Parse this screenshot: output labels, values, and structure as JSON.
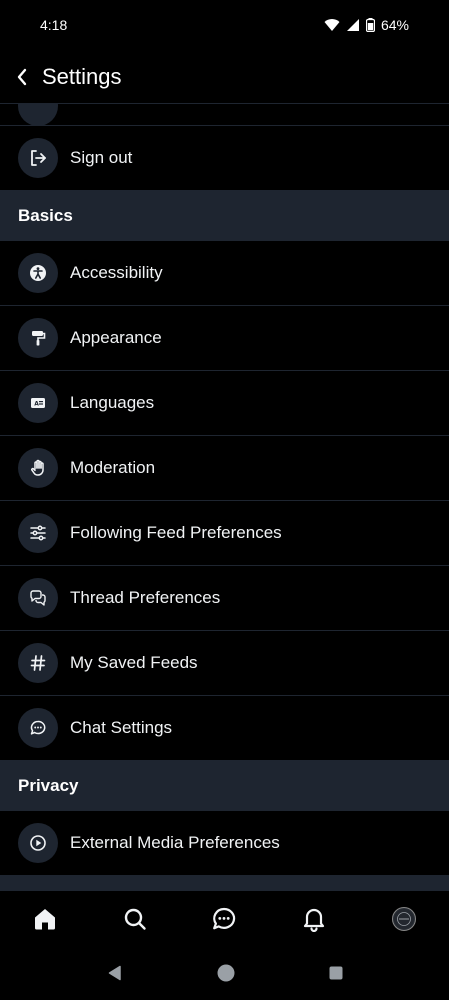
{
  "status_bar": {
    "time": "4:18",
    "battery": "64%"
  },
  "header": {
    "title": "Settings"
  },
  "rows_top": [
    {
      "label": "Sign out",
      "icon": "sign-out-icon"
    }
  ],
  "sections": [
    {
      "title": "Basics",
      "items": [
        {
          "label": "Accessibility",
          "icon": "accessibility-icon"
        },
        {
          "label": "Appearance",
          "icon": "paint-roller-icon"
        },
        {
          "label": "Languages",
          "icon": "languages-icon"
        },
        {
          "label": "Moderation",
          "icon": "hand-icon"
        },
        {
          "label": "Following Feed Preferences",
          "icon": "sliders-icon"
        },
        {
          "label": "Thread Preferences",
          "icon": "chat-bubbles-icon"
        },
        {
          "label": "My Saved Feeds",
          "icon": "hashtag-icon"
        },
        {
          "label": "Chat Settings",
          "icon": "chat-icon"
        }
      ]
    },
    {
      "title": "Privacy",
      "items": [
        {
          "label": "External Media Preferences",
          "icon": "play-circle-icon"
        }
      ]
    }
  ],
  "bottom_nav": [
    "home-icon",
    "search-icon",
    "chat-icon",
    "bell-icon",
    "avatar"
  ],
  "system_nav": [
    "back-triangle-icon",
    "home-circle-icon",
    "recents-square-icon"
  ]
}
